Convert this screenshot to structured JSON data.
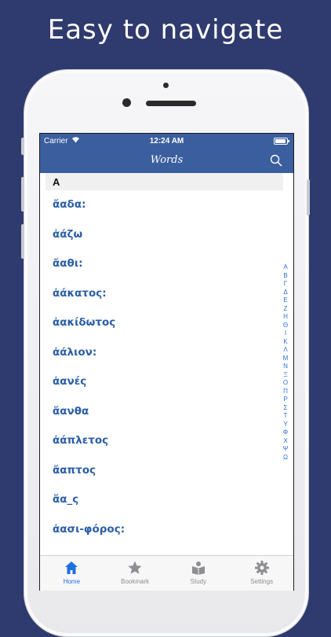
{
  "promo_title": "Easy to navigate",
  "status": {
    "carrier": "Carrier",
    "time": "12:24 AM"
  },
  "nav": {
    "title": "Words"
  },
  "section": "A",
  "words": [
    "ἄαδα:",
    "ἀάζω",
    "ἄαθι:",
    "ἀάκατος:",
    "ἀακίδωτος",
    "ἀάλιον:",
    "ἀανές",
    "ἄανθα",
    "ἀάπλετος",
    "ἄαπτος",
    "ἄα_ς",
    "ἀασι-φόρος:"
  ],
  "index_letters": [
    "Α",
    "Β",
    "Γ",
    "Δ",
    "Ε",
    "Ζ",
    "Η",
    "Θ",
    "Ι",
    "Κ",
    "Λ",
    "Μ",
    "Ν",
    "Ξ",
    "Ο",
    "Π",
    "Ρ",
    "Σ",
    "Τ",
    "Υ",
    "Φ",
    "Χ",
    "Ψ",
    "Ω"
  ],
  "tabs": [
    {
      "label": "Home",
      "icon": "home-icon",
      "active": true
    },
    {
      "label": "Bookmark",
      "icon": "star-icon",
      "active": false
    },
    {
      "label": "Study",
      "icon": "study-icon",
      "active": false
    },
    {
      "label": "Settings",
      "icon": "gear-icon",
      "active": false
    }
  ],
  "colors": {
    "accent": "#3a5e9e",
    "link": "#2a5ea6",
    "tab_active": "#1e6fe0",
    "background": "#2f3a6e"
  }
}
